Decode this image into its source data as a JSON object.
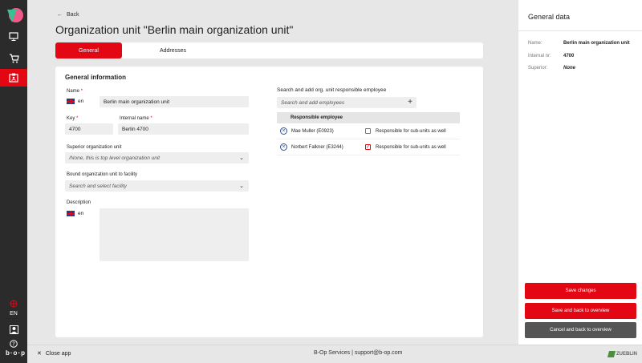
{
  "nav": {
    "language": "EN"
  },
  "header": {
    "back_label": "Back",
    "title": "Organization unit \"Berlin main organization unit\""
  },
  "tabs": [
    {
      "label": "General",
      "active": true
    },
    {
      "label": "Addresses",
      "active": false
    }
  ],
  "form": {
    "section_title": "General information",
    "name_label": "Name",
    "name_lang": "en",
    "name_value": "Berlin main organization unit",
    "key_label": "Key",
    "key_value": "4700",
    "internal_name_label": "Internal name",
    "internal_name_value": "Berlin 4700",
    "required_mark": "*",
    "superior_label": "Superior organization unit",
    "superior_value": "/None, this is top level organization unit",
    "facility_label": "Bound organization unit to facility",
    "facility_placeholder": "Search and select facility",
    "description_label": "Description",
    "description_lang": "en"
  },
  "employees": {
    "search_label": "Search and add org. unit responsible employee",
    "search_placeholder": "Search and add employees",
    "column_header": "Responsible employee",
    "rows": [
      {
        "name": "Mae Muller (E0923)",
        "checkbox_label": "Responsible for sub-units as well",
        "checked": false
      },
      {
        "name": "Norbert Falkner (E3244)",
        "checkbox_label": "Responsible for sub-units as well",
        "checked": true
      }
    ]
  },
  "panel": {
    "title": "General data",
    "name_key": "Name:",
    "name_value": "Berlin main organization unit",
    "internal_key": "Internal nr:",
    "internal_value": "4700",
    "superior_key": "Superior:",
    "superior_value": "None",
    "save_label": "Save changes",
    "save_back_label": "Save and back to overview",
    "cancel_label": "Cancel and back to overview"
  },
  "footer": {
    "close_label": "Close app",
    "services_text": "B-Op Services | support@b-op.com",
    "brand_text": "ZUEBLIN"
  },
  "colors": {
    "accent": "#e30613",
    "rail": "#2b2b2b",
    "neutral_button": "#555555",
    "link_icon": "#1e4fb5"
  }
}
